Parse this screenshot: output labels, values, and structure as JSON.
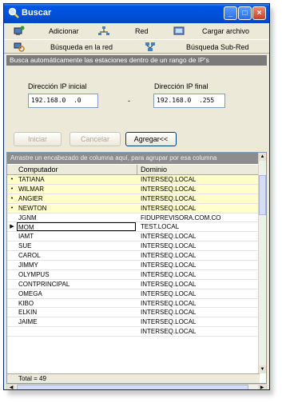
{
  "window": {
    "title": "Buscar"
  },
  "toolbar": {
    "add_label": "Adicionar",
    "network_label": "Red",
    "upload_label": "Cargar archivo",
    "network_search_label": "Búsqueda en la red",
    "subnet_search_label": "Búsqueda Sub-Red"
  },
  "banner": {
    "text": "Busca automáticamente las estaciones dentro de un rango de IP's"
  },
  "range": {
    "start_label": "Dirección IP inicial",
    "start_value": "192.168.0  .0",
    "dash": "-",
    "end_label": "Dirección IP final",
    "end_value": "192.168.0  .255"
  },
  "buttons": {
    "start": "Iniciar",
    "cancel": "Cancelar",
    "add": "Agregar<<"
  },
  "grid": {
    "group_hint": "Arrastre un encabezado de columna aquí, para agrupar por esa columna",
    "col_computer": "Computador",
    "col_domain": "Dominio",
    "rows": [
      {
        "computer": "TATIANA",
        "domain": "INTERSEQ.LOCAL",
        "hl": true,
        "ind": "•"
      },
      {
        "computer": "WILMAR",
        "domain": "INTERSEQ.LOCAL",
        "hl": true,
        "ind": "•"
      },
      {
        "computer": "ANGIER",
        "domain": "INTERSEQ.LOCAL",
        "hl": true,
        "ind": "•"
      },
      {
        "computer": "NEWTON",
        "domain": "INTERSEQ.LOCAL",
        "hl": true,
        "ind": "•"
      },
      {
        "computer": "JGNM",
        "domain": "FIDUPREVISORA.COM.CO",
        "hl": false,
        "ind": ""
      },
      {
        "computer": "MOM",
        "domain": "TEST.LOCAL",
        "hl": false,
        "ind": "▶",
        "cur": true
      },
      {
        "computer": "IAMT",
        "domain": "INTERSEQ.LOCAL",
        "hl": false,
        "ind": ""
      },
      {
        "computer": "SUE",
        "domain": "INTERSEQ.LOCAL",
        "hl": false,
        "ind": ""
      },
      {
        "computer": "CAROL",
        "domain": "INTERSEQ.LOCAL",
        "hl": false,
        "ind": ""
      },
      {
        "computer": "JIMMY",
        "domain": "INTERSEQ.LOCAL",
        "hl": false,
        "ind": ""
      },
      {
        "computer": "OLYMPUS",
        "domain": "INTERSEQ.LOCAL",
        "hl": false,
        "ind": ""
      },
      {
        "computer": "CONTPRINCIPAL",
        "domain": "INTERSEQ.LOCAL",
        "hl": false,
        "ind": ""
      },
      {
        "computer": "OMEGA",
        "domain": "INTERSEQ.LOCAL",
        "hl": false,
        "ind": ""
      },
      {
        "computer": "KIBO",
        "domain": "INTERSEQ.LOCAL",
        "hl": false,
        "ind": ""
      },
      {
        "computer": "ELKIN",
        "domain": "INTERSEQ.LOCAL",
        "hl": false,
        "ind": ""
      },
      {
        "computer": "JAIME",
        "domain": "INTERSEQ.LOCAL",
        "hl": false,
        "ind": ""
      },
      {
        "computer": "",
        "domain": "INTERSEQ.LOCAL",
        "hl": false,
        "ind": ""
      }
    ],
    "total": "Total = 49"
  },
  "icons": {
    "title": "search-icon",
    "add": "add-computer-icon",
    "network": "network-icon",
    "upload": "upload-file-icon",
    "network_search": "network-search-icon",
    "subnet_search": "subnet-search-icon"
  },
  "colors": {
    "titlebar": "#0055e5",
    "window_bg": "#ece9d8",
    "highlight_row": "#ffffcc",
    "banner": "#7a7a7a"
  }
}
